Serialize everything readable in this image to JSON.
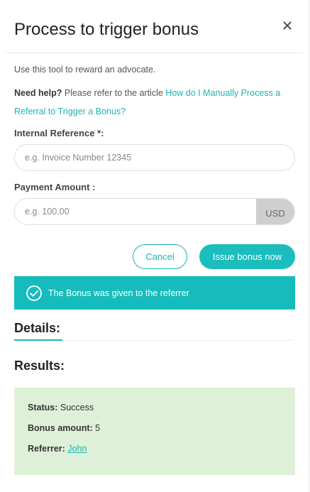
{
  "modal": {
    "title": "Process to trigger bonus",
    "close_icon": "close-icon"
  },
  "intro": "Use this tool to reward an advocate.",
  "help": {
    "label": "Need help?",
    "text": "Please refer to the article",
    "link": "How do I Manually Process a Referral to Trigger a Bonus?"
  },
  "form": {
    "internal_reference": {
      "label": "Internal Reference *:",
      "value": "",
      "placeholder": "e.g. Invoice Number 12345"
    },
    "payment_amount": {
      "label": "Payment Amount :",
      "value": "",
      "placeholder": "e.g. 100.00",
      "currency": "USD"
    }
  },
  "actions": {
    "cancel_label": "Cancel",
    "issue_label": "Issue bonus now"
  },
  "banner": {
    "icon": "check-circle-icon",
    "message": "The Bonus was given to the referrer"
  },
  "details": {
    "title": "Details:"
  },
  "results": {
    "title": "Results:",
    "status_label": "Status:",
    "status_value": "Success",
    "bonus_label": "Bonus amount:",
    "bonus_value": "5",
    "referrer_label": "Referrer:",
    "referrer_value": "John"
  },
  "colors": {
    "accent": "#1bbdbd",
    "success_bg": "#dff0d8",
    "currency_bg": "#cfcfcf"
  }
}
